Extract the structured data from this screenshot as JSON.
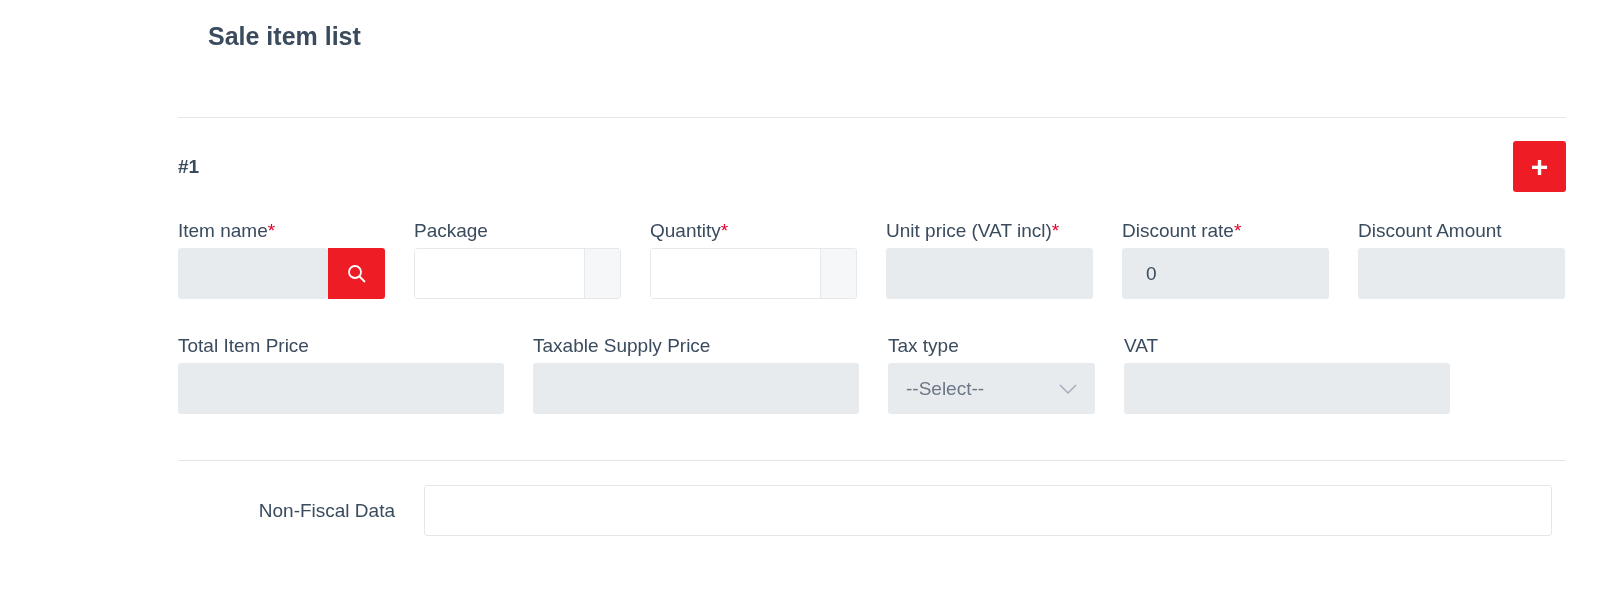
{
  "title": "Sale item list",
  "item": {
    "number": "#1",
    "add_button": "+",
    "row_1": [
      {
        "kind": "search",
        "label": "Item name",
        "required_mark": "*"
      },
      {
        "kind": "addon",
        "label": "Package"
      },
      {
        "kind": "addon",
        "label": "Quantity",
        "required_mark": "*"
      },
      {
        "kind": "readonly",
        "label": "Unit price (VAT incl)",
        "required_mark": "*"
      },
      {
        "kind": "readonly",
        "label": "Discount rate",
        "required_mark": "*",
        "value": "0"
      },
      {
        "kind": "readonly",
        "label": "Discount Amount"
      }
    ],
    "row_2": [
      {
        "kind": "readonly",
        "label": "Total Item Price"
      },
      {
        "kind": "readonly",
        "label": "Taxable Supply Price"
      },
      {
        "kind": "select",
        "label": "Tax type",
        "value": "--Select--"
      },
      {
        "kind": "readonly",
        "label": "VAT"
      }
    ]
  },
  "non_fiscal": {
    "label": "Non-Fiscal Data"
  }
}
